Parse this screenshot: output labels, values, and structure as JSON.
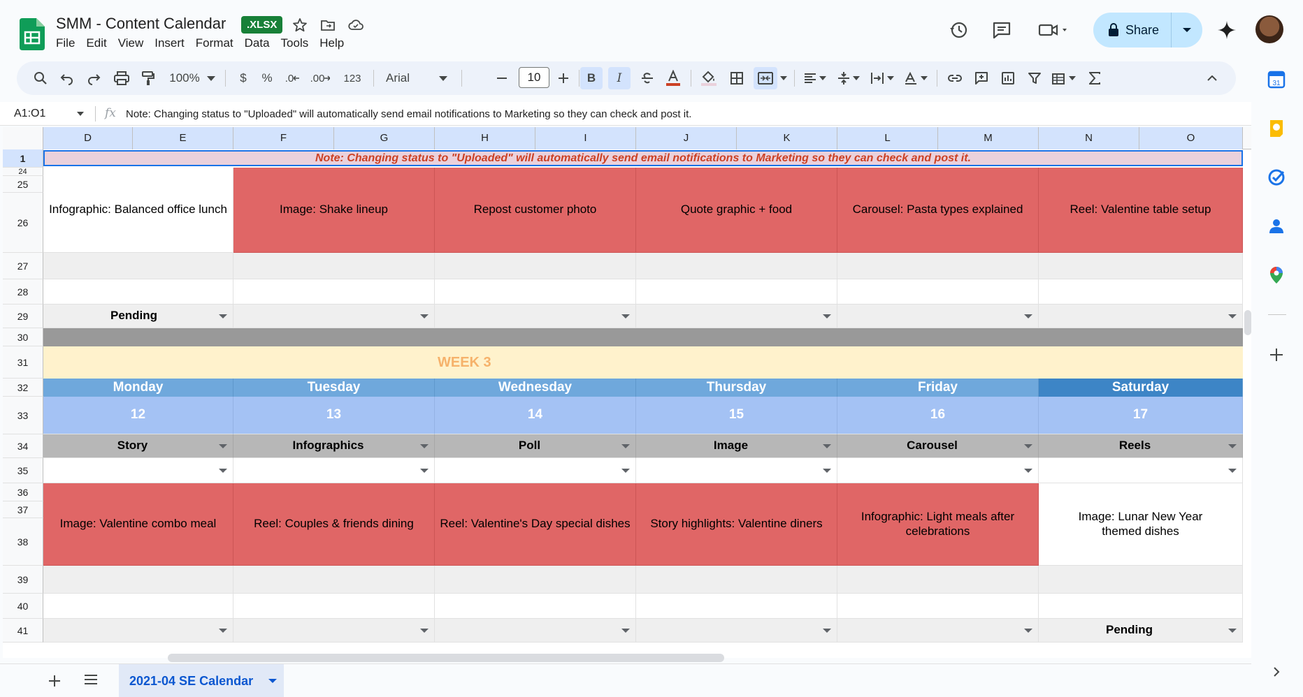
{
  "app": {
    "doc_title": "SMM - Content Calendar",
    "file_badge": ".XLSX",
    "menu": [
      "File",
      "Edit",
      "View",
      "Insert",
      "Format",
      "Data",
      "Tools",
      "Help"
    ],
    "share_label": "Share"
  },
  "toolbar": {
    "zoom": "100%",
    "currency": "$",
    "percent": "%",
    "decrease_decimal": ".0",
    "increase_decimal": ".00",
    "number_format": "123",
    "font": "Arial",
    "font_size": "10",
    "bold": "B",
    "italic": "I"
  },
  "formula_bar": {
    "name_box": "A1:O1",
    "fx": "fx",
    "content": "Note: Changing status to \"Uploaded\" will automatically send email notifications to Marketing so they can check and post it."
  },
  "columns": [
    "D",
    "E",
    "F",
    "G",
    "H",
    "I",
    "J",
    "K",
    "L",
    "M",
    "N",
    "O"
  ],
  "rows": [
    "1",
    "24",
    "25",
    "26",
    "27",
    "28",
    "29",
    "30",
    "31",
    "32",
    "33",
    "34",
    "35",
    "36",
    "37",
    "38",
    "39",
    "40",
    "41"
  ],
  "note": "Note: Changing status to \"Uploaded\" will automatically send email notifications to Marketing so they can check and post it.",
  "week2_content": [
    "Infographic: Balanced office lunch",
    "Image: Shake lineup",
    "Repost customer photo",
    "Quote graphic + food",
    "Carousel: Pasta types explained",
    "Reel: Valentine table setup"
  ],
  "week2_status": [
    "Pending",
    "",
    "",
    "",
    "",
    ""
  ],
  "week3": {
    "label": "WEEK 3",
    "days": [
      "Monday",
      "Tuesday",
      "Wednesday",
      "Thursday",
      "Friday",
      "Saturday"
    ],
    "dates": [
      "12",
      "13",
      "14",
      "15",
      "16",
      "17"
    ],
    "types": [
      "Story",
      "Infographics",
      "Poll",
      "Image",
      "Carousel",
      "Reels"
    ],
    "content": [
      "Image: Valentine combo meal",
      "Reel: Couples & friends dining",
      "Reel: Valentine's Day special dishes",
      "Story highlights: Valentine diners",
      "Infographic: Light meals after celebrations",
      "Image: Lunar New Year themed dishes"
    ],
    "status": [
      "",
      "",
      "",
      "",
      "",
      "Pending"
    ]
  },
  "sheet_tab": "2021-04 SE Calendar",
  "colors": {
    "red_cell": "#e06666",
    "day_header": "#6fa8dc",
    "saturday_header": "#3d85c6",
    "date_row": "#a4c2f4",
    "type_row": "#b7b7b7",
    "week_banner": "#fff2cc",
    "note_banner": "#ead1dc"
  },
  "icons": {
    "top": [
      "sheets-logo",
      "star-icon",
      "move-folder-icon",
      "cloud-status-icon",
      "history-icon",
      "comment-icon",
      "meet-icon",
      "lock-icon",
      "gemini-icon"
    ],
    "side": [
      "calendar-icon",
      "keep-icon",
      "tasks-icon",
      "contacts-icon",
      "maps-icon",
      "add-icon"
    ]
  }
}
